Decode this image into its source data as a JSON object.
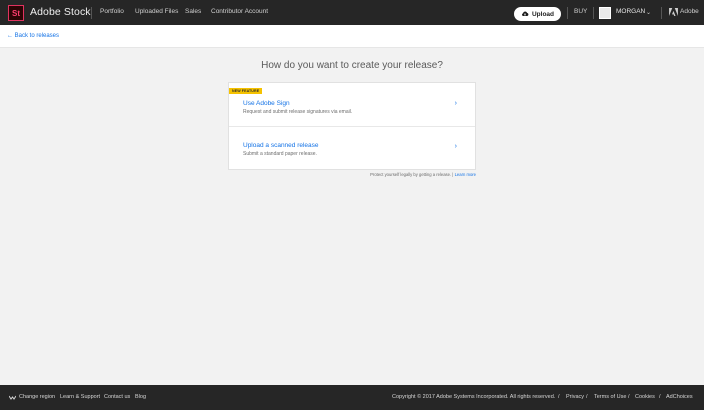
{
  "header": {
    "logo_text": "St",
    "brand": "Adobe Stock",
    "nav": [
      "Portfolio",
      "Uploaded Files",
      "Sales",
      "Contributor Account"
    ],
    "upload_label": "Upload",
    "buy_label": "BUY",
    "user_name": "MORGAN",
    "adobe_label": "Adobe"
  },
  "subheader": {
    "back_link": "← Back to releases"
  },
  "main": {
    "title": "How do you want to create your release?",
    "options": [
      {
        "badge": "NEW FEATURE",
        "title": "Use Adobe Sign",
        "subtitle": "Request and submit release signatures via email."
      },
      {
        "title": "Upload a scanned release",
        "subtitle": "Submit a standard paper release."
      }
    ],
    "protect_text": "Protect yourself legally by getting a release. |",
    "learn_more": "Learn more"
  },
  "footer": {
    "left_links": [
      "Change region",
      "Learn & Support",
      "Contact us",
      "Blog"
    ],
    "copyright": "Copyright © 2017 Adobe Systems Incorporated. All rights reserved.",
    "right_links": [
      "Privacy",
      "Terms of Use",
      "Cookies",
      "AdChoices"
    ],
    "separator": "/"
  },
  "colors": {
    "accent": "#1473e6",
    "header_bg": "#262626",
    "badge": "#f5c200",
    "logo": "#ff3f6f"
  }
}
